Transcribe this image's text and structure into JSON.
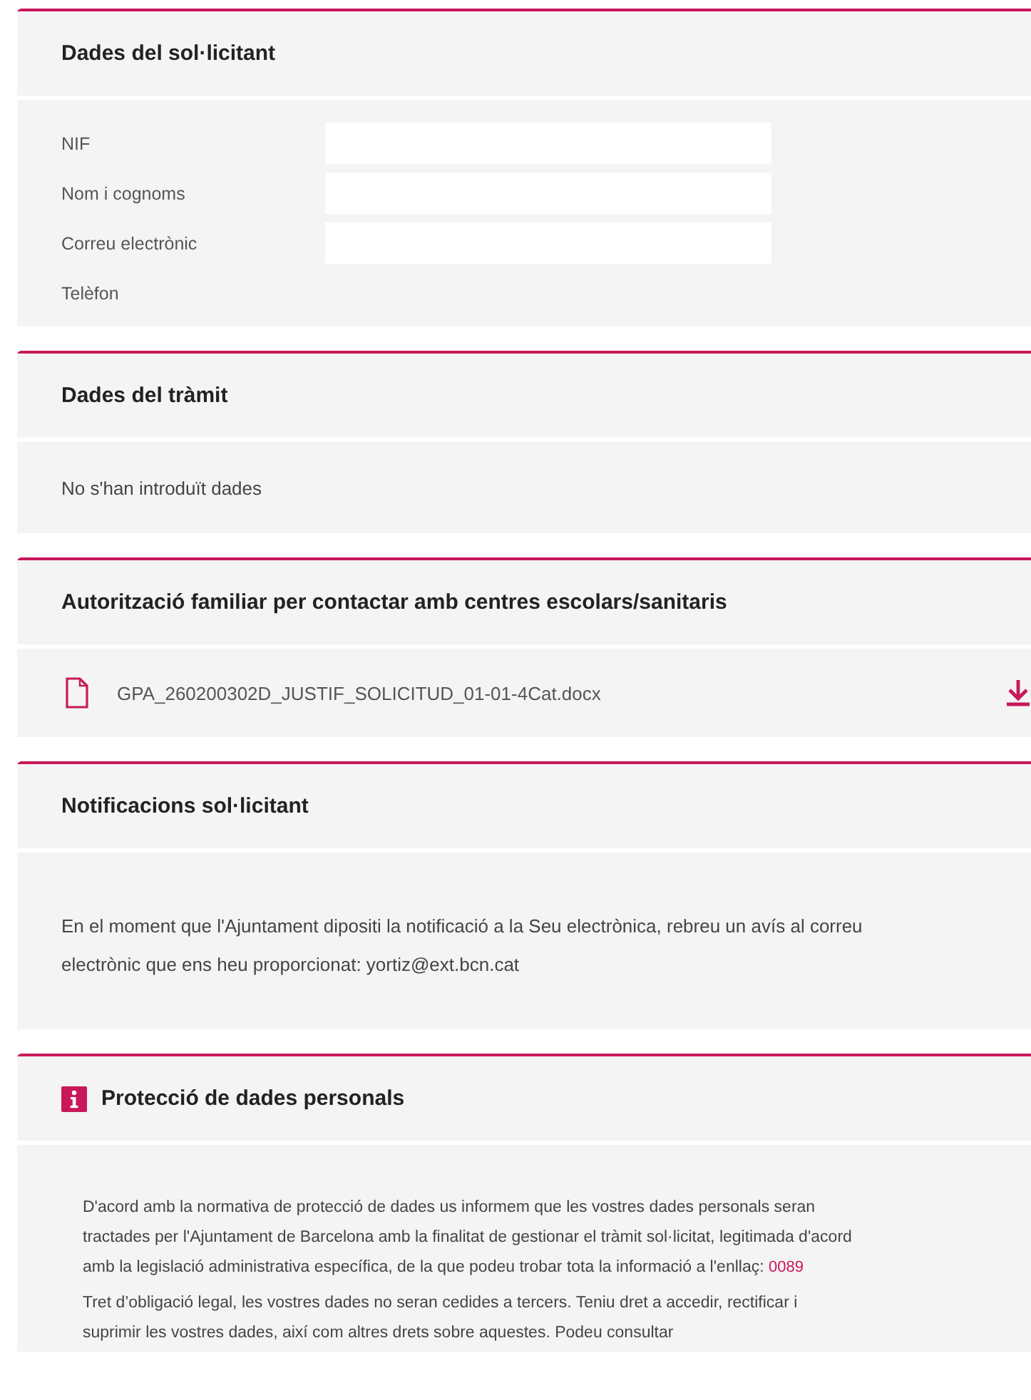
{
  "sections": [
    {
      "title": "Dades del sol·licitant",
      "kind": "fields",
      "info_icon": false,
      "fields": [
        {
          "label": "NIF",
          "kind": "input"
        },
        {
          "label": "Nom i cognoms",
          "kind": "input"
        },
        {
          "label": "Correu electrònic",
          "kind": "input"
        },
        {
          "label": "Telèfon",
          "kind": "plain"
        }
      ]
    },
    {
      "title": "Dades del tràmit",
      "kind": "text",
      "info_icon": false,
      "text": "No s'han introduït dades"
    },
    {
      "title": "Autorització familiar per contactar amb centres escolars/sanitaris",
      "kind": "file",
      "info_icon": false,
      "file": "GPA_260200302D_JUSTIF_SOLICITUD_01-01-4Cat.docx"
    },
    {
      "title": "Notificacions sol·licitant",
      "kind": "notice",
      "info_icon": false,
      "text": "En el moment que l'Ajuntament dipositi la notificació a la Seu electrònica, rebreu un avís al correu electrònic que ens heu proporcionat: yortiz@ext.bcn.cat"
    },
    {
      "title": "Protecció de dades personals",
      "kind": "info",
      "info_icon": true,
      "paragraphs": [
        {
          "text": "D'acord amb la normativa de protecció de dades us informem que les vostres dades personals seran tractades per l'Ajuntament de Barcelona amb la finalitat de gestionar el tràmit sol·licitat, legitimada d'acord amb la legislació administrativa específica, de la que podeu trobar tota la informació a l'enllaç:",
          "link": "0089"
        },
        {
          "text": "Tret d’obligació legal, les vostres dades no seran cedides a tercers. Teniu dret a accedir, rectificar i suprimir les vostres dades, així com altres drets sobre aquestes. Podeu consultar"
        }
      ]
    }
  ]
}
